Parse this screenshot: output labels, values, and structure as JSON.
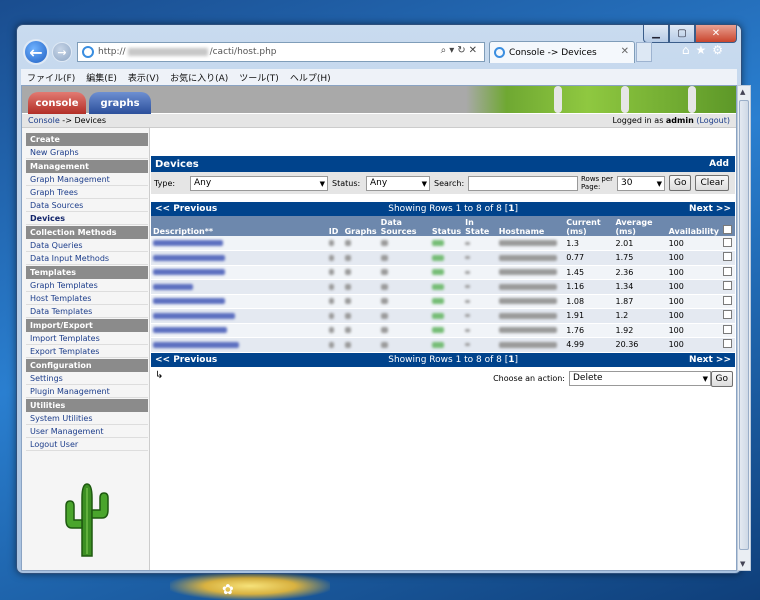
{
  "browser": {
    "url_prefix": "http://",
    "url_suffix": "/cacti/host.php",
    "tab_title": "Console -> Devices",
    "menu": [
      "ファイル(F)",
      "編集(E)",
      "表示(V)",
      "お気に入り(A)",
      "ツール(T)",
      "ヘルプ(H)"
    ]
  },
  "cacti": {
    "tabs": {
      "console": "console",
      "graphs": "graphs"
    },
    "breadcrumb": {
      "link": "Console",
      "separator": " -> ",
      "current": "Devices"
    },
    "login": {
      "prefix": "Logged in as ",
      "user": "admin",
      "logout": "(Logout)"
    }
  },
  "sidebar": [
    {
      "type": "head",
      "label": "Create"
    },
    {
      "type": "link",
      "label": "New Graphs"
    },
    {
      "type": "head",
      "label": "Management"
    },
    {
      "type": "link",
      "label": "Graph Management"
    },
    {
      "type": "link",
      "label": "Graph Trees"
    },
    {
      "type": "link",
      "label": "Data Sources"
    },
    {
      "type": "link",
      "label": "Devices",
      "active": true
    },
    {
      "type": "head",
      "label": "Collection Methods"
    },
    {
      "type": "link",
      "label": "Data Queries"
    },
    {
      "type": "link",
      "label": "Data Input Methods"
    },
    {
      "type": "head",
      "label": "Templates"
    },
    {
      "type": "link",
      "label": "Graph Templates"
    },
    {
      "type": "link",
      "label": "Host Templates"
    },
    {
      "type": "link",
      "label": "Data Templates"
    },
    {
      "type": "head",
      "label": "Import/Export"
    },
    {
      "type": "link",
      "label": "Import Templates"
    },
    {
      "type": "link",
      "label": "Export Templates"
    },
    {
      "type": "head",
      "label": "Configuration"
    },
    {
      "type": "link",
      "label": "Settings"
    },
    {
      "type": "link",
      "label": "Plugin Management"
    },
    {
      "type": "head",
      "label": "Utilities"
    },
    {
      "type": "link",
      "label": "System Utilities"
    },
    {
      "type": "link",
      "label": "User Management"
    },
    {
      "type": "link",
      "label": "Logout User"
    }
  ],
  "devices": {
    "title": "Devices",
    "add_label": "Add",
    "filter": {
      "type_label": "Type:",
      "type_value": "Any",
      "status_label": "Status:",
      "status_value": "Any",
      "search_label": "Search:",
      "search_value": "",
      "rows_label": "Rows per Page:",
      "rows_value": "30",
      "go_label": "Go",
      "clear_label": "Clear"
    },
    "pager": {
      "prev": "<< Previous",
      "showing_prefix": "Showing Rows 1 to 8 of 8 [",
      "page": "1",
      "showing_suffix": "]",
      "next": "Next >>"
    },
    "columns": [
      "Description**",
      "ID",
      "Graphs",
      "Data Sources",
      "Status",
      "In State",
      "Hostname",
      "Current (ms)",
      "Average (ms)",
      "Availability"
    ],
    "rows": [
      {
        "current": "1.3",
        "average": "2.01",
        "availability": "100"
      },
      {
        "current": "0.77",
        "average": "1.75",
        "availability": "100"
      },
      {
        "current": "1.45",
        "average": "2.36",
        "availability": "100"
      },
      {
        "current": "1.16",
        "average": "1.34",
        "availability": "100"
      },
      {
        "current": "1.08",
        "average": "1.87",
        "availability": "100"
      },
      {
        "current": "1.91",
        "average": "1.2",
        "availability": "100"
      },
      {
        "current": "1.76",
        "average": "1.92",
        "availability": "100"
      },
      {
        "current": "4.99",
        "average": "20.36",
        "availability": "100"
      }
    ],
    "action": {
      "label": "Choose an action:",
      "value": "Delete",
      "go_label": "Go"
    }
  }
}
